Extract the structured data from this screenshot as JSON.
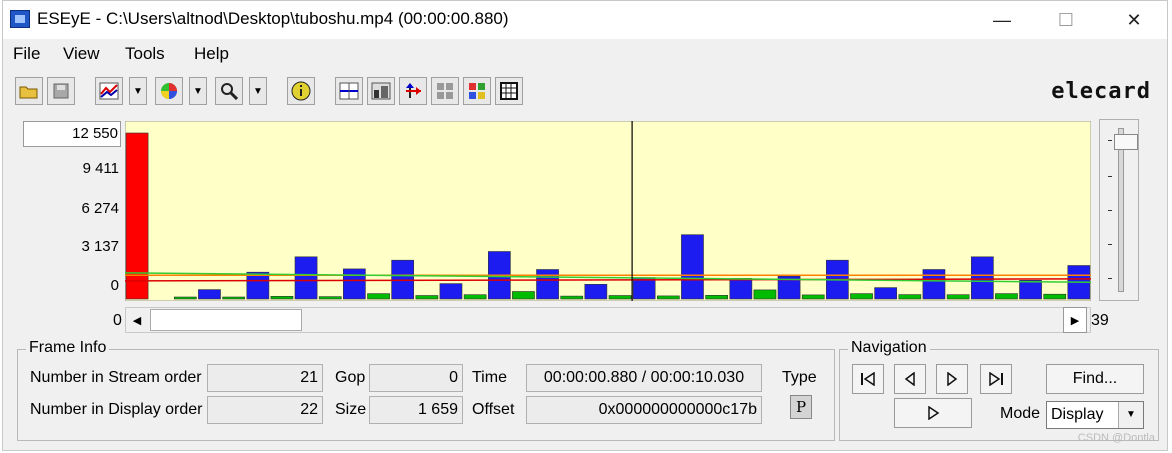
{
  "window": {
    "title": "ESEyE - C:\\Users\\altnod\\Desktop\\tuboshu.mp4 (00:00:00.880)",
    "minimize": "—",
    "maximize": "☐",
    "close": "✕"
  },
  "menu": [
    "File",
    "View",
    "Tools",
    "Help"
  ],
  "brand": "elecard",
  "chart_data": {
    "type": "bar",
    "yticks": [
      "12 550",
      "9 411",
      "6 274",
      "3 137",
      "0"
    ],
    "ylim": [
      0,
      12550
    ],
    "x_start_label": "0",
    "x_end_label": "39",
    "cursor_frame": 21,
    "series": [
      {
        "name": "I",
        "color": "#ff0000",
        "frames": [
          0
        ],
        "values": [
          12400
        ]
      },
      {
        "name": "P",
        "color": "#1c1cf0",
        "frames": [
          3,
          5,
          7,
          9,
          11,
          13,
          15,
          17,
          19,
          21,
          23,
          25,
          27,
          29,
          31,
          33,
          35,
          37,
          39
        ],
        "values": [
          700,
          2000,
          3150,
          2250,
          2900,
          1150,
          3550,
          2200,
          1100,
          1600,
          4800,
          1550,
          1700,
          2900,
          850,
          2200,
          3150,
          1400,
          2500
        ]
      },
      {
        "name": "B",
        "color": "#00bb00",
        "frames": [
          2,
          4,
          6,
          8,
          10,
          12,
          14,
          16,
          18,
          20,
          22,
          24,
          26,
          28,
          30,
          32,
          34,
          36,
          38
        ],
        "values": [
          150,
          120,
          200,
          180,
          400,
          260,
          320,
          560,
          220,
          260,
          230,
          280,
          680,
          310,
          400,
          330,
          320,
          400,
          360
        ]
      }
    ],
    "lines": [
      {
        "name": "orange",
        "color": "#ff8000",
        "level": 1780
      },
      {
        "name": "red",
        "color": "#dd0000",
        "level_start": 1350,
        "level_end": 1500
      },
      {
        "name": "green",
        "color": "#33cc33",
        "level_start": 1950,
        "level_end": 1250
      }
    ],
    "background": "#ffffc8"
  },
  "frame_info": {
    "title": "Frame Info",
    "stream_order_label": "Number in Stream order",
    "stream_order_value": "21",
    "display_order_label": "Number in Display order",
    "display_order_value": "22",
    "gop_label": "Gop",
    "gop_value": "0",
    "size_label": "Size",
    "size_value": "1 659",
    "time_label": "Time",
    "time_value": "00:00:00.880 / 00:00:10.030",
    "offset_label": "Offset",
    "offset_value": "0x000000000000c17b",
    "type_label": "Type",
    "type_value": "P"
  },
  "navigation": {
    "title": "Navigation",
    "find_label": "Find...",
    "mode_label": "Mode",
    "mode_value": "Display"
  },
  "watermark": "CSDN @Dontla"
}
